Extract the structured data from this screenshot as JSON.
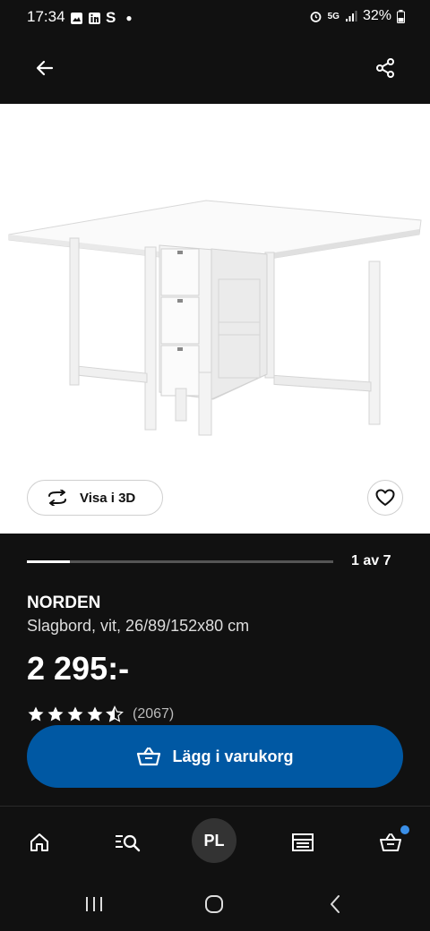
{
  "status_bar": {
    "time": "17:34",
    "left_icons": [
      "gallery-icon",
      "linkedin-icon",
      "s-icon",
      "dot"
    ],
    "battery": "32%",
    "right_icons": [
      "alarm-icon",
      "5g-icon",
      "signal-icon",
      "battery-icon"
    ]
  },
  "top_bar": {
    "back_icon": "arrow-left-icon",
    "share_icon": "share-icon"
  },
  "media": {
    "view_3d_label": "Visa i 3D",
    "carousel_count": "1 av 7",
    "carousel_progress": 0.14
  },
  "product": {
    "name": "NORDEN",
    "description": "Slagbord, vit, 26/89/152x80 cm",
    "price": "2 295:-",
    "rating": 4.5,
    "rating_count": "(2067)"
  },
  "add_to_cart": {
    "label": "Lägg i varukorg"
  },
  "bottom_nav": {
    "items": [
      {
        "name": "home-icon"
      },
      {
        "name": "search-icon"
      },
      {
        "name": "profile",
        "label": "PL"
      },
      {
        "name": "store-icon"
      },
      {
        "name": "cart-icon"
      }
    ],
    "accent": "#0058a3",
    "badge_color": "#3a8fe8"
  },
  "system_nav": {
    "items": [
      "recents-icon",
      "home-circle-icon",
      "back-chevron-icon"
    ]
  }
}
